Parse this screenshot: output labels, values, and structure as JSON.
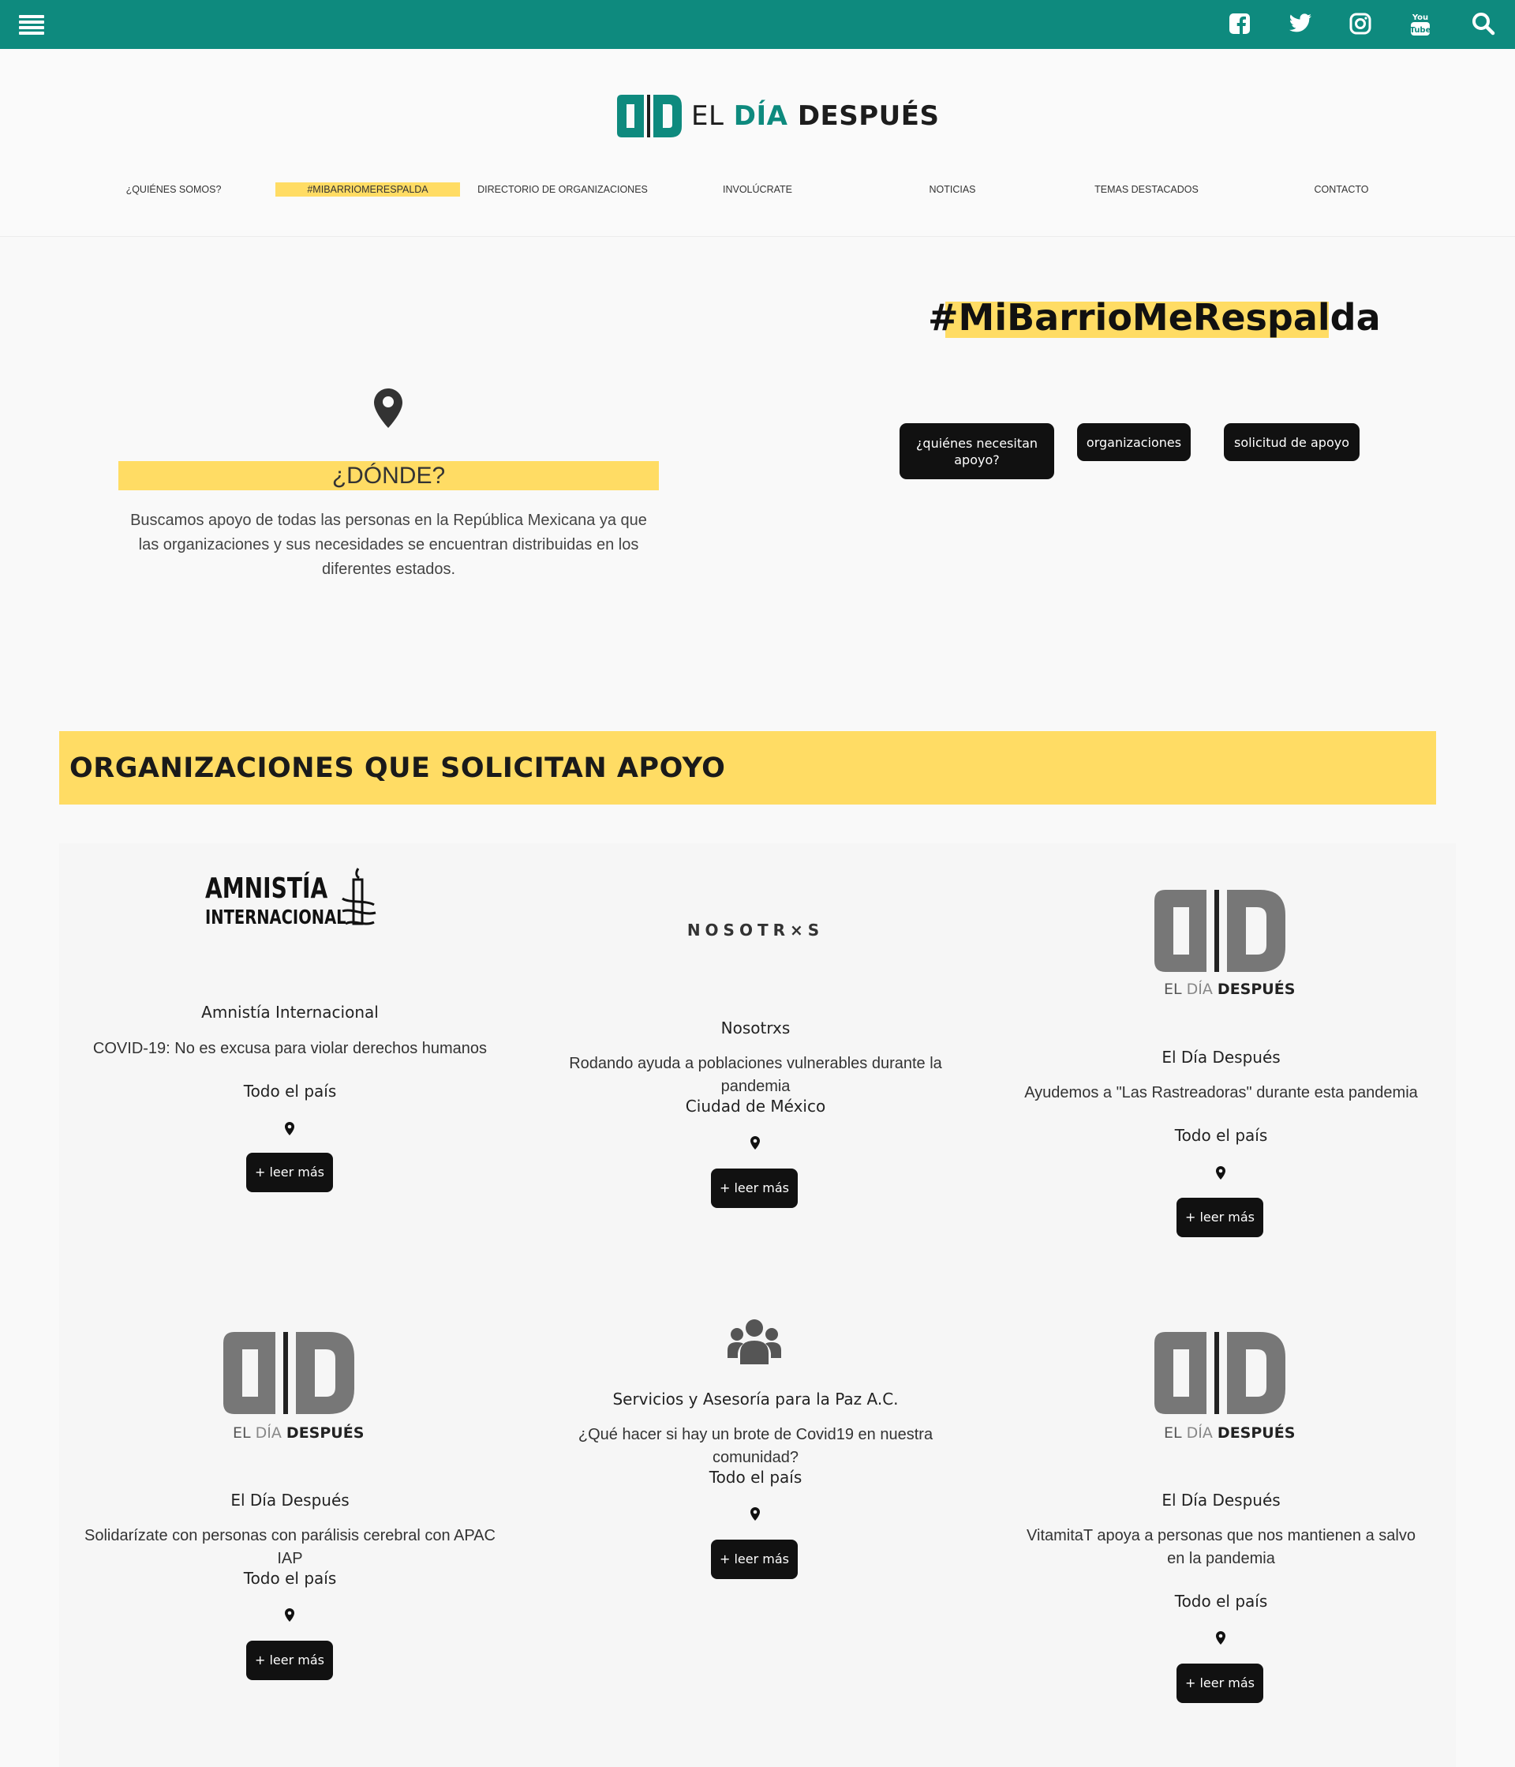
{
  "topbar": {
    "icons": [
      "menu-icon",
      "facebook-icon",
      "twitter-icon",
      "instagram-icon",
      "youtube-icon",
      "search-icon"
    ]
  },
  "brand": {
    "el": "EL",
    "dia": "DÍA",
    "despues": "DESPUÉS"
  },
  "nav": {
    "items": [
      "¿QUIÉNES SOMOS?",
      "#MIBARRIOMERESPALDA",
      "DIRECTORIO DE ORGANIZACIONES",
      "INVOLÚCRATE",
      "NOTICIAS",
      "TEMAS DESTACADOS",
      "CONTACTO"
    ]
  },
  "hero": {
    "donde_title": "¿DÓNDE?",
    "donde_text": "Buscamos apoyo de todas las personas en la República Mexicana ya que las organizaciones y sus necesidades se encuentran distribuidas en los diferentes estados.",
    "hashtag": "#MiBarrioMeRespalda",
    "buttons": [
      "¿quiénes necesitan apoyo?",
      "organizaciones",
      "solicitud de apoyo"
    ]
  },
  "orgs": {
    "title": "ORGANIZACIONES QUE SOLICITAN APOYO",
    "read_more": "+ leer más",
    "amnistia_logo": {
      "line1": "AMNISTÍA",
      "line2": "INTERNACIONAL"
    },
    "nosotrxs_logo": "NOSOTR×S",
    "cards": [
      {
        "name": "Amnistía Internacional",
        "desc": "COVID-19: No es excusa para violar derechos humanos",
        "loc": "Todo el país"
      },
      {
        "name": "Nosotrxs",
        "desc": "Rodando ayuda a poblaciones vulnerables durante la pandemia",
        "loc": "Ciudad de México"
      },
      {
        "name": "El Día Después",
        "desc": "Ayudemos a \"Las Rastreadoras\" durante esta pandemia",
        "loc": "Todo el país"
      },
      {
        "name": "El Día Después",
        "desc": "Solidarízate con personas con parálisis cerebral con APAC IAP",
        "loc": "Todo el país"
      },
      {
        "name": "Servicios y Asesoría para la Paz A.C.",
        "desc": "¿Qué hacer si hay un brote de Covid19 en nuestra comunidad?",
        "loc": "Todo el país"
      },
      {
        "name": "El Día Después",
        "desc": "VitamitaT apoya a personas que nos mantienen a salvo en la pandemia",
        "loc": "Todo el país"
      }
    ]
  },
  "colors": {
    "teal": "#0e8a7e",
    "yellow": "#ffdc64",
    "dark": "#111111"
  }
}
